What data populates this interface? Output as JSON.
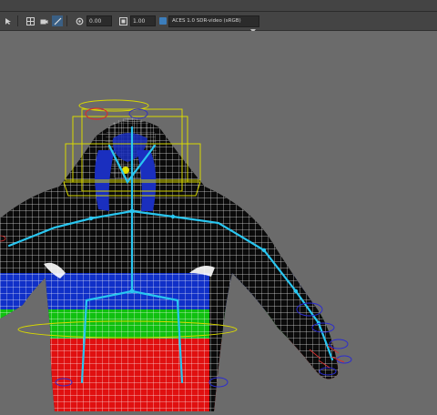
{
  "toolbar": {
    "field_a": "0.00",
    "field_b": "1.00",
    "color_space": "ACES 1.0 SDR-video (sRGB)",
    "icons": [
      "select-icon",
      "grid-icon",
      "camera-icon",
      "snap-icon",
      "exposure-icon",
      "gamma-icon",
      "color-management-icon"
    ]
  },
  "viewport": {
    "mode": "wireframe-on-shaded",
    "colors": {
      "background": "#6b6b6b",
      "wire": "#ffffff",
      "skeleton": "#29c6f0",
      "ik_control": "#d8d800",
      "skin_black": "#0b0b0b",
      "skin_blue": "#1030c8",
      "skin_green": "#10c010",
      "skin_red": "#e01010"
    }
  }
}
